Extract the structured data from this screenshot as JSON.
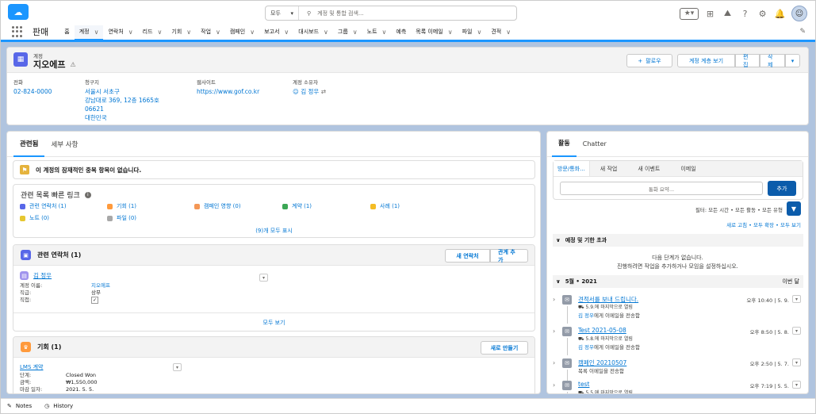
{
  "global_search": {
    "scope": "모두",
    "placeholder": "계정 및 통합 검색..."
  },
  "app_name": "판매",
  "nav": [
    {
      "label": "홈",
      "chev": false,
      "active": false
    },
    {
      "label": "계정",
      "chev": true,
      "active": true
    },
    {
      "label": "연락처",
      "chev": true,
      "active": false
    },
    {
      "label": "리드",
      "chev": true,
      "active": false
    },
    {
      "label": "기회",
      "chev": true,
      "active": false
    },
    {
      "label": "작업",
      "chev": true,
      "active": false
    },
    {
      "label": "캠페인",
      "chev": true,
      "active": false
    },
    {
      "label": "보고서",
      "chev": true,
      "active": false
    },
    {
      "label": "대시보드",
      "chev": true,
      "active": false
    },
    {
      "label": "그룹",
      "chev": true,
      "active": false
    },
    {
      "label": "노트",
      "chev": true,
      "active": false
    },
    {
      "label": "예측",
      "chev": false,
      "active": false
    },
    {
      "label": "목록 이메일",
      "chev": true,
      "active": false
    },
    {
      "label": "파일",
      "chev": true,
      "active": false
    },
    {
      "label": "견적",
      "chev": true,
      "active": false
    }
  ],
  "record": {
    "object_label": "계정",
    "name": "지오에프",
    "buttons": {
      "follow": "팔로우",
      "hierarchy": "계정 계층 보기",
      "edit": "편집",
      "delete": "삭제"
    },
    "fields": {
      "phone_label": "전화",
      "phone": "02-824-0000",
      "address_label": "청구지",
      "address_lines": [
        "서울시 서초구",
        "강남대로 369, 12층 1665호",
        "06621",
        "대한민국"
      ],
      "website_label": "웹사이트",
      "website": "https://www.gof.co.kr",
      "owner_label": "계정 소유자",
      "owner": "김 정우"
    }
  },
  "left_tabs": {
    "related": "관련됨",
    "details": "세부 사항"
  },
  "duplicate_msg": "이 계정의 잠재적인 중복 항목이 없습니다.",
  "quick_links": {
    "title": "관련 목록 빠른 링크",
    "items": [
      {
        "label": "관련 연락처 (1)",
        "color": "#5867e8"
      },
      {
        "label": "기회 (1)",
        "color": "#ff9a3c"
      },
      {
        "label": "캠페인 영향 (0)",
        "color": "#f49756"
      },
      {
        "label": "계약 (1)",
        "color": "#3ba755"
      },
      {
        "label": "사례 (1)",
        "color": "#f4bc25"
      },
      {
        "label": "노트 (0)",
        "color": "#e6c730"
      },
      {
        "label": "파일 (0)",
        "color": "#a8a8a8"
      }
    ],
    "show_all": "(9)개 모두 표시"
  },
  "contacts_card": {
    "title": "관련 연락처 (1)",
    "new_btn": "새 연락처",
    "add_btn": "관계 추가",
    "name": "김 정우",
    "rows": [
      {
        "k": "계정 이름:",
        "v": "지오에프",
        "link": true
      },
      {
        "k": "직급:",
        "v": "상무",
        "link": false
      },
      {
        "k": "직접:",
        "v": "✓",
        "link": false
      }
    ],
    "view_all": "모두 보기"
  },
  "opp_card": {
    "title": "기회 (1)",
    "new_btn": "새로 만들기",
    "name": "LMS 계약",
    "rows": [
      {
        "k": "단계:",
        "v": "Closed Won"
      },
      {
        "k": "금액:",
        "v": "₩1,550,000"
      },
      {
        "k": "마감 일자:",
        "v": "2021. 5. 5."
      }
    ]
  },
  "right_tabs": {
    "activity": "활동",
    "chatter": "Chatter"
  },
  "activity": {
    "subtabs": [
      "방문/통화...",
      "새 작업",
      "새 이벤트",
      "이메일"
    ],
    "call_placeholder": "통화 요약...",
    "add_btn": "추가",
    "filter_text": "필터: 모든 시간 • 모든 활동 • 모든 유형",
    "refresh_text": "새로 고침 • 모두 확장 • 모두 보기",
    "upcoming_title": "예정 및 기한 초과",
    "empty_line1": "다음 단계가 없습니다.",
    "empty_line2": "진행하려면 작업을 추가하거나 모임을 설정하십시오.",
    "month_title": "5월 • 2021",
    "month_right": "이번 달",
    "items": [
      {
        "title": "견적서를 보내 드립니다.",
        "meta": "5.9.에 마지막으로 열림",
        "who": "김 정우",
        "action": "에게 이메일을 전송함",
        "date": "오후 10:40 | 5. 9."
      },
      {
        "title": "Test 2021-05-08",
        "meta": "5.8.에 마지막으로 열림",
        "who": "김 정우",
        "action": "에게 이메일을 전송함",
        "date": "오후 8:50 | 5. 8."
      },
      {
        "title": "캠페인 20210507",
        "meta": "",
        "who": "",
        "action": "목록 이메일을 전송함",
        "date": "오후 2:50 | 5. 7."
      },
      {
        "title": "test",
        "meta": "5.5.에 마지막으로 열림",
        "who": "",
        "action": "",
        "date": "오후 7:19 | 5. 5."
      }
    ]
  },
  "footer": {
    "notes": "Notes",
    "history": "History"
  }
}
